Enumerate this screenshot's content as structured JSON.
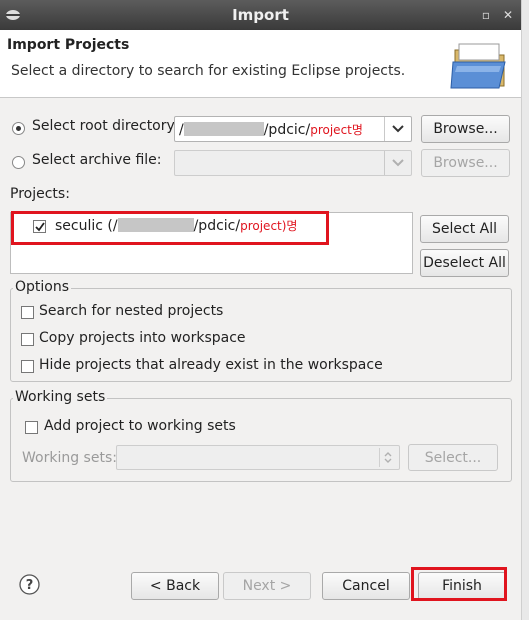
{
  "window": {
    "title": "Import"
  },
  "header": {
    "title": "Import Projects",
    "subtitle": "Select a directory to search for existing Eclipse projects."
  },
  "source": {
    "root_label": "Select root directory:",
    "root_path_prefix": "/",
    "root_path_mid": "/pdcic/",
    "root_path_red": "project",
    "root_path_suffix": "명",
    "archive_label": "Select archive file:",
    "browse_label": "Browse...",
    "browse_archive_label": "Browse..."
  },
  "projects": {
    "label": "Projects:",
    "items": [
      {
        "name_prefix": "seculic (/",
        "name_mid": "/pdcic/",
        "name_red": "project",
        "name_suffix": ")명",
        "checked": true
      }
    ],
    "select_all": "Select All",
    "deselect_all": "Deselect All"
  },
  "options": {
    "legend": "Options",
    "items": [
      {
        "label": "Search for nested projects",
        "checked": false
      },
      {
        "label": "Copy projects into workspace",
        "checked": false
      },
      {
        "label": "Hide projects that already exist in the workspace",
        "checked": false
      }
    ]
  },
  "working_sets": {
    "legend": "Working sets",
    "add_label": "Add project to working sets",
    "sets_label": "Working sets:",
    "select_label": "Select..."
  },
  "footer": {
    "help_icon": "?",
    "back": "< Back",
    "next": "Next >",
    "cancel": "Cancel",
    "finish": "Finish"
  },
  "colors": {
    "highlight": "#e0141e",
    "titlebar": "#3a3a3a"
  }
}
